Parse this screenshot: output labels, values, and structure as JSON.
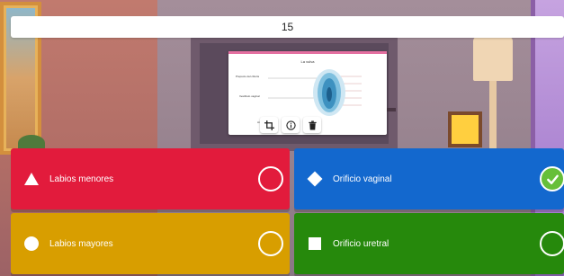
{
  "question": {
    "text": "15"
  },
  "media": {
    "title": "La vulva",
    "labels": [
      "Prepucio del clítoris",
      "Vestíbulo vaginal",
      "An"
    ],
    "tools": [
      {
        "icon": "crop-icon"
      },
      {
        "icon": "info-icon"
      },
      {
        "icon": "trash-icon"
      }
    ]
  },
  "answers": [
    {
      "label": "Labios menores",
      "shape": "triangle-icon",
      "color": "#e21b3c",
      "selected": false
    },
    {
      "label": "Orificio vaginal",
      "shape": "diamond-icon",
      "color": "#1368ce",
      "selected": true
    },
    {
      "label": "Labios mayores",
      "shape": "circle-icon",
      "color": "#d89e00",
      "selected": false
    },
    {
      "label": "Orificio uretral",
      "shape": "square-icon",
      "color": "#26890c",
      "selected": false
    }
  ],
  "colors": {
    "check": "#66bf39"
  }
}
